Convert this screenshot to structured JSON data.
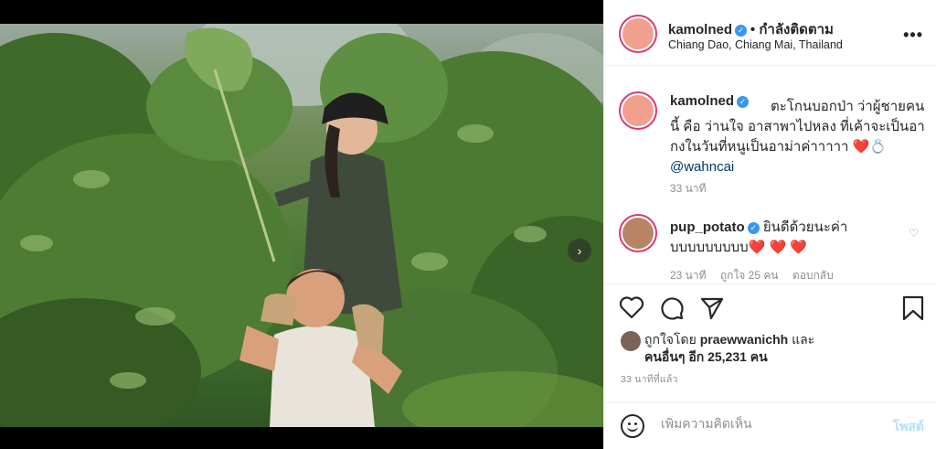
{
  "post": {
    "username": "kamolned",
    "verified": true,
    "follow_status": "• กำลังติดตาม",
    "location": "Chiang Dao, Chiang Mai, Thailand",
    "more_label": "•••"
  },
  "caption": {
    "username": "kamolned",
    "text": "ตะโกนบอกป่า ว่าผู้ชายคนนี้ คือ ว่านใจ อาสาพาไปหลง ที่เค้าจะเป็นอากงในวันที่หนูเป็นอาม่าค่าาาาา",
    "emoji": "❤️💍",
    "mention": "@wahncai",
    "time": "33 นาที"
  },
  "comment": {
    "username": "pup_potato",
    "verified": true,
    "text": "ยินดีด้วยนะค่าบบบบบบบบบ",
    "emoji": "❤️ ❤️ ❤️",
    "time": "23 นาที",
    "likes": "ถูกใจ 25 คน",
    "reply": "ตอบกลับ"
  },
  "likes": {
    "prefix": "ถูกใจโดย",
    "user": "praewwanichh",
    "conj": "และ",
    "others": "คนอื่นๆ อีก 25,231 คน"
  },
  "posted_ago": "33 นาทีที่แล้ว",
  "composer": {
    "placeholder": "เพิ่มความคิดเห็น",
    "post_label": "โพสต์"
  },
  "carousel": {
    "next_label": "›",
    "slide_count": 3,
    "active_slide": 1
  },
  "colors": {
    "verified": "#3897f0",
    "avatar_ring": "#d93a74",
    "heart": "#ed4956",
    "post_disabled": "#b2dffc"
  }
}
